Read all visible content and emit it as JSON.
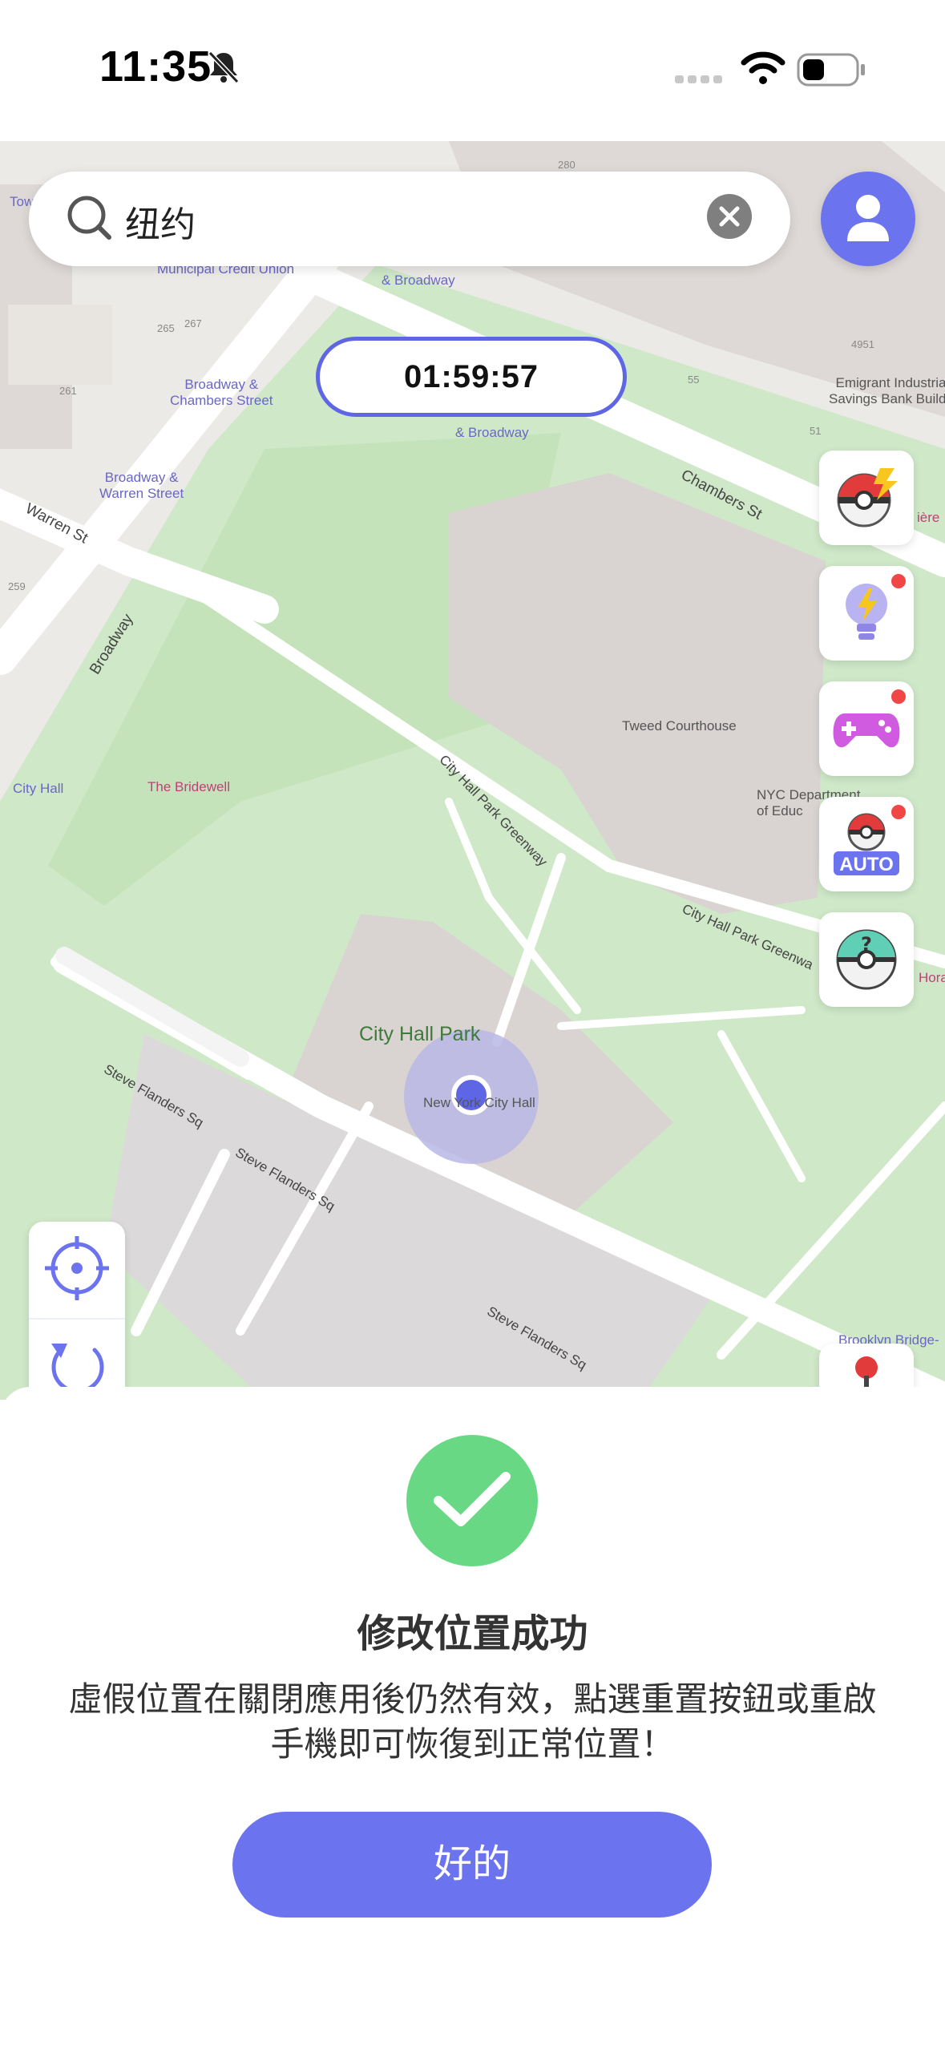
{
  "status_bar": {
    "time": "11:35",
    "icons": [
      "silent-bell-icon",
      "signal-icon",
      "wifi-icon",
      "battery-icon"
    ]
  },
  "search": {
    "value": "纽约",
    "icons": [
      "search-icon",
      "clear-icon"
    ]
  },
  "profile_button": {
    "icon": "user-icon"
  },
  "timer": {
    "value": "01:59:57"
  },
  "map_labels": {
    "broadway_chambers": "Broadway &\nChambers Street",
    "broadway_warren": "Broadway &\nWarren Street",
    "municipal": "Municipal Credit Union",
    "chambers_broadway_top": "& Broadway",
    "chambers_broadway_mid": "& Broadway",
    "chambers_st": "Chambers St",
    "warren_st": "Warren St",
    "broadway": "Broadway",
    "tweed": "Tweed Courthouse",
    "emigrant": "Emigrant Industrial\nSavings Bank Buildi",
    "nyc_dept": "NYC Department\nof Educ",
    "city_hall_station": "City Hall",
    "bridewell": "The Bridewell",
    "city_hall_greenway_1": "City Hall Park Greenway",
    "city_hall_greenway_2": "City Hall Park Greenwa",
    "city_hall_park": "City Hall Park",
    "new_city_hall": "New York City Hall",
    "steve_flanders_1": "Steve Flanders Sq",
    "steve_flanders_2": "Steve Flanders Sq",
    "steve_flanders_3": "Steve Flanders Sq",
    "brooklyn_bridge": "Brooklyn Bridge-",
    "tow": "Tow",
    "n280": "280",
    "n265": "265",
    "n267": "267",
    "n261": "261",
    "n259": "259",
    "n55": "55",
    "n51": "51",
    "n4951": "4951",
    "horace": "Hora",
    "lumiere": "ière"
  },
  "side_tools": [
    {
      "name": "pokeball-lightning-icon",
      "badge": false
    },
    {
      "name": "lightbulb-icon",
      "badge": true
    },
    {
      "name": "gamepad-icon",
      "badge": true
    },
    {
      "name": "auto-pokeball-icon",
      "badge": true,
      "label": "AUTO"
    },
    {
      "name": "question-ball-icon",
      "badge": false
    }
  ],
  "left_tools": [
    "locate-icon",
    "reset-icon"
  ],
  "dialog": {
    "title": "修改位置成功",
    "description": "虛假位置在關閉應用後仍然有效，點選重置按鈕或重啟手機即可恢復到正常位置！",
    "ok_label": "好的",
    "accent_color": "#6c73ee",
    "success_color": "#69d884"
  }
}
